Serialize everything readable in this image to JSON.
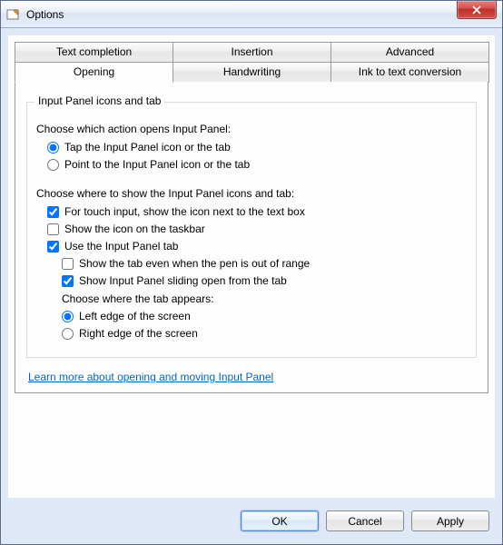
{
  "window": {
    "title": "Options"
  },
  "tabs": {
    "row1": {
      "a": "Text completion",
      "b": "Insertion",
      "c": "Advanced"
    },
    "row2": {
      "a": "Opening",
      "b": "Handwriting",
      "c": "Ink to text conversion"
    }
  },
  "group": {
    "legend": "Input Panel icons and tab",
    "prompt1": "Choose which action opens Input Panel:",
    "radio1a": "Tap the Input Panel icon or the tab",
    "radio1b": "Point to the Input Panel icon or the tab",
    "prompt2": "Choose where to show the Input Panel icons and tab:",
    "chk_a": "For touch input, show the icon next to the text box",
    "chk_b": "Show the icon on the taskbar",
    "chk_c": "Use the Input Panel tab",
    "sub_a": "Show the tab even when the pen is out of range",
    "sub_b": "Show Input Panel sliding open from the tab",
    "sub_prompt": "Choose where the tab appears:",
    "sub_r1": "Left edge of the screen",
    "sub_r2": "Right edge of the screen"
  },
  "link": "Learn more about opening and moving Input Panel",
  "buttons": {
    "ok": "OK",
    "cancel": "Cancel",
    "apply": "Apply"
  }
}
